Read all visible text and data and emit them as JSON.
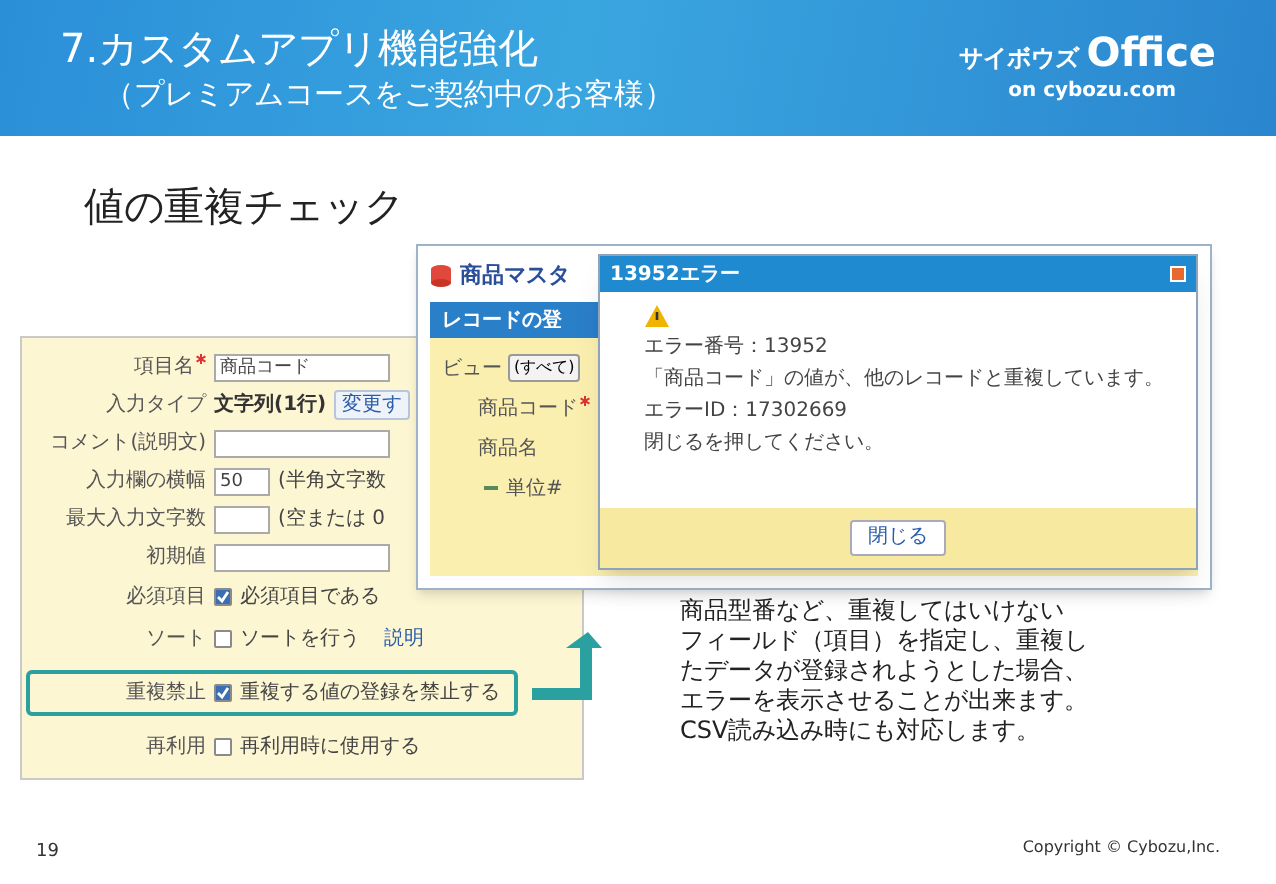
{
  "header": {
    "title": "7.カスタムアプリ機能強化",
    "subtitle": "（プレミアムコースをご契約中のお客様）",
    "logo": {
      "brand": "サイボウズ",
      "product": "Office",
      "tagline": "on cybozu.com"
    }
  },
  "heading": "値の重複チェック",
  "form": {
    "rows": [
      {
        "kind": "input",
        "label": "項目名",
        "required": true,
        "value": "商品コード"
      },
      {
        "kind": "type",
        "label": "入力タイプ",
        "required": false,
        "value": "文字列(1行)",
        "button": "変更す"
      },
      {
        "kind": "input",
        "label": "コメント(説明文)",
        "required": false
      },
      {
        "kind": "short_input",
        "label": "入力欄の横幅",
        "required": false,
        "value": "50",
        "suffix": "(半角文字数"
      },
      {
        "kind": "short_input",
        "label": "最大入力文字数",
        "required": false,
        "suffix": "(空または 0"
      },
      {
        "kind": "input",
        "label": "初期値",
        "required": false
      },
      {
        "kind": "checkbox",
        "label": "必須項目",
        "text": "必須項目である",
        "checked": true,
        "highlighted": false
      },
      {
        "kind": "checkbox",
        "label": "ソート",
        "text": "ソートを行う",
        "checked": false,
        "link": "説明",
        "highlighted": false
      },
      {
        "kind": "checkbox",
        "label": "重複禁止",
        "text": "重複する値の登録を禁止する",
        "checked": true,
        "highlighted": true
      },
      {
        "kind": "checkbox",
        "label": "再利用",
        "text": "再利用時に使用する",
        "checked": false,
        "highlighted": false
      }
    ]
  },
  "record_window": {
    "title": "商品マスタ",
    "section": "レコードの登",
    "rows": [
      {
        "kind": "select",
        "label": "ビュー",
        "value": "(すべて)"
      },
      {
        "kind": "field",
        "label": "商品コード",
        "required": true
      },
      {
        "kind": "field",
        "label": "商品名",
        "required": false
      },
      {
        "kind": "lookup",
        "label": "単位#",
        "required": false
      }
    ]
  },
  "error_dialog": {
    "title": "13952エラー",
    "lines": [
      "エラー番号：13952",
      "「商品コード」の値が、他のレコードと重複しています。",
      "エラーID：17302669",
      "閉じるを押してください。"
    ],
    "button": "閉じる"
  },
  "description_lines": [
    "商品型番など、重複してはいけない",
    "フィールド（項目）を指定し、重複し",
    "たデータが登録されようとした場合、",
    "エラーを表示させることが出来ます。",
    "CSV読み込み時にも対応します。"
  ],
  "footer": {
    "page": "19",
    "copyright": "Copyright © Cybozu,Inc."
  }
}
